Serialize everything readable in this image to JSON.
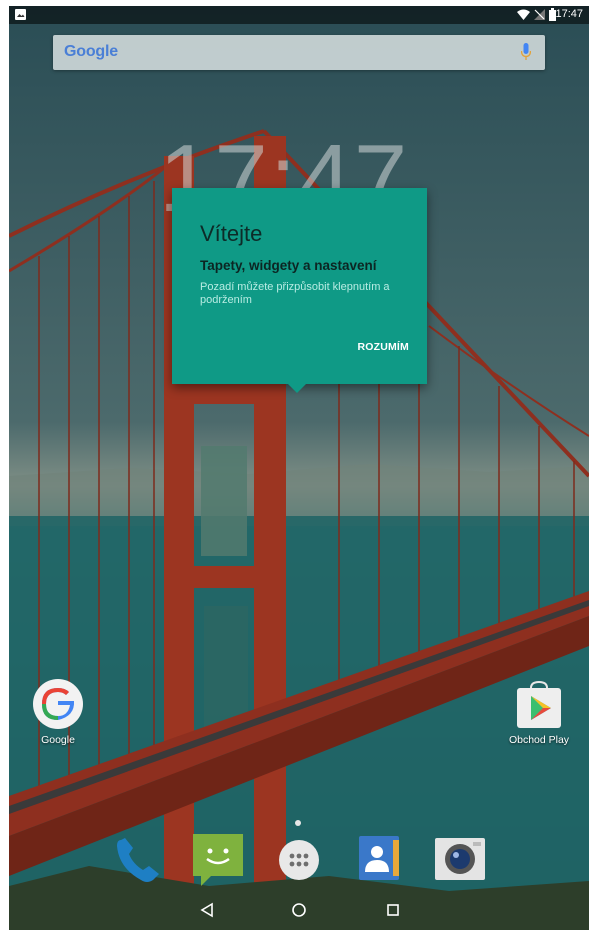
{
  "status_bar": {
    "time": "17:47"
  },
  "search": {
    "logo": "Google"
  },
  "clock": {
    "time": "17:47"
  },
  "welcome": {
    "title": "Vítejte",
    "subtitle": "Tapety, widgety a nastavení",
    "body": "Pozadí můžete přizpůsobit klepnutím a podržením",
    "button": "ROZUMÍM"
  },
  "shortcuts": [
    {
      "label": "Google",
      "icon": "google-icon"
    },
    {
      "label": "Obchod Play",
      "icon": "play-store-icon"
    }
  ],
  "dock": [
    {
      "icon": "phone-icon"
    },
    {
      "icon": "messaging-icon"
    },
    {
      "icon": "app-drawer-icon"
    },
    {
      "icon": "contacts-icon"
    },
    {
      "icon": "camera-icon"
    }
  ],
  "nav": [
    "back-icon",
    "home-icon",
    "recents-icon"
  ],
  "colors": {
    "card": "#0f9a86",
    "accent": "#ffffff"
  }
}
